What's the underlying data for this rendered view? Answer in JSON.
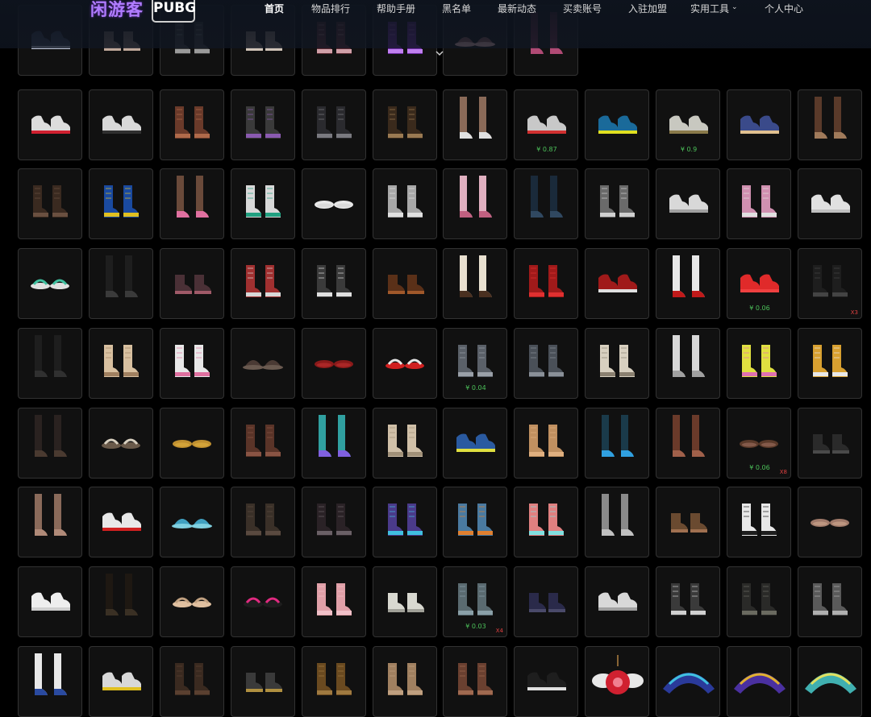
{
  "header": {
    "logo_main": "闲游客",
    "logo_sub": "PUBG",
    "nav": [
      {
        "label": "首页",
        "active": true
      },
      {
        "label": "物品排行"
      },
      {
        "label": "帮助手册"
      },
      {
        "label": "黑名单"
      },
      {
        "label": "最新动态"
      },
      {
        "label": "买卖账号"
      },
      {
        "label": "入驻加盟"
      },
      {
        "label": "实用工具",
        "dropdown": true
      },
      {
        "label": "个人中心"
      }
    ]
  },
  "colors": {
    "background": "#000000",
    "tile_border": "#323232",
    "price_green": "#4cc25a",
    "qty_red": "#e04040"
  },
  "items": [
    {
      "icon": "sneaker-pair-icon",
      "colors": [
        "#3a4256",
        "#bcc2d4"
      ]
    },
    {
      "icon": "low-boot-pair-icon",
      "colors": [
        "#7a6a62",
        "#c0a89a"
      ]
    },
    {
      "icon": "boot-pair-icon",
      "colors": [
        "#3a3a3a",
        "#9a9a9a"
      ]
    },
    {
      "icon": "low-boot-pair-icon",
      "colors": [
        "#8a7c72",
        "#d0c4b8"
      ]
    },
    {
      "icon": "boot-pair-icon",
      "colors": [
        "#5a2a32",
        "#d0a0a8"
      ]
    },
    {
      "icon": "boot-pair-icon",
      "colors": [
        "#6a2aa0",
        "#c080f0"
      ]
    },
    {
      "icon": "hat-pair-icon",
      "colors": [
        "#8a5a5a",
        "#e0b0b0"
      ]
    },
    {
      "icon": "tall-sock-pair-icon",
      "colors": [
        "#6a2a44",
        "#b04a74"
      ]
    },
    {
      "icon": "sneaker-pair-icon",
      "colors": [
        "#dcdcdc",
        "#d02030"
      ]
    },
    {
      "icon": "sneaker-pair-icon",
      "colors": [
        "#d8d8d8",
        "#303030"
      ]
    },
    {
      "icon": "boot-pair-icon",
      "colors": [
        "#6a3a2a",
        "#b06a4a"
      ]
    },
    {
      "icon": "boot-pair-icon",
      "colors": [
        "#3a3a3a",
        "#8a5ab0"
      ]
    },
    {
      "icon": "boot-pair-icon",
      "colors": [
        "#2a2a2e",
        "#7a7a80"
      ]
    },
    {
      "icon": "boot-pair-icon",
      "colors": [
        "#3a2a1c",
        "#9a7a52"
      ]
    },
    {
      "icon": "tall-sock-pair-icon",
      "colors": [
        "#8a6a58",
        "#e0e0e0"
      ]
    },
    {
      "icon": "sneaker-pair-icon",
      "colors": [
        "#c8c8c8",
        "#d03030"
      ],
      "price": "¥ 0.87"
    },
    {
      "icon": "sneaker-pair-icon",
      "colors": [
        "#1a6a9a",
        "#e0e020"
      ]
    },
    {
      "icon": "sneaker-pair-icon",
      "colors": [
        "#c8c8c0",
        "#8a7a4a"
      ],
      "price": "¥ 0.9"
    },
    {
      "icon": "sneaker-pair-icon",
      "colors": [
        "#3a4a8a",
        "#e0c090"
      ]
    },
    {
      "icon": "tall-sock-pair-icon",
      "colors": [
        "#5a3a2a",
        "#a07a5a"
      ]
    },
    {
      "icon": "boot-pair-icon",
      "colors": [
        "#3a2a20",
        "#6a5040"
      ]
    },
    {
      "icon": "boot-pair-icon",
      "colors": [
        "#1a4aa0",
        "#e0c020"
      ]
    },
    {
      "icon": "tall-sock-pair-icon",
      "colors": [
        "#6a4a3a",
        "#e070a0"
      ]
    },
    {
      "icon": "boot-pair-icon",
      "colors": [
        "#d8d8d8",
        "#20a080"
      ]
    },
    {
      "icon": "flat-pair-icon",
      "colors": [
        "#e8e8e8",
        "#d0d0d0"
      ]
    },
    {
      "icon": "boot-pair-icon",
      "colors": [
        "#a8a8a8",
        "#e0e0e0"
      ]
    },
    {
      "icon": "tall-sock-pair-icon",
      "colors": [
        "#e0b0c0",
        "#c06080"
      ]
    },
    {
      "icon": "tall-sock-pair-icon",
      "colors": [
        "#1a2a3a",
        "#304860"
      ]
    },
    {
      "icon": "boot-pair-icon",
      "colors": [
        "#6a6a6a",
        "#d0d0d0"
      ]
    },
    {
      "icon": "sneaker-pair-icon",
      "colors": [
        "#d8d8d8",
        "#a0a0a0"
      ]
    },
    {
      "icon": "boot-pair-icon",
      "colors": [
        "#d090b0",
        "#e0e0e0"
      ]
    },
    {
      "icon": "sneaker-pair-icon",
      "colors": [
        "#e0e0e0",
        "#c0c0c0"
      ]
    },
    {
      "icon": "sandal-pair-icon",
      "colors": [
        "#40c0a0",
        "#e0e0e0"
      ]
    },
    {
      "icon": "tall-sock-pair-icon",
      "colors": [
        "#1e1e1e",
        "#3a3a3a"
      ]
    },
    {
      "icon": "low-boot-pair-icon",
      "colors": [
        "#4a3036",
        "#a05a68"
      ]
    },
    {
      "icon": "boot-pair-icon",
      "colors": [
        "#a03030",
        "#d8d8d8"
      ]
    },
    {
      "icon": "boot-pair-icon",
      "colors": [
        "#3a3a3a",
        "#e0e0e0"
      ]
    },
    {
      "icon": "low-boot-pair-icon",
      "colors": [
        "#5a3018",
        "#a0582a"
      ]
    },
    {
      "icon": "tall-sock-pair-icon",
      "colors": [
        "#e8e0d0",
        "#4a3020"
      ]
    },
    {
      "icon": "boot-pair-icon",
      "colors": [
        "#a01a1a",
        "#e03030"
      ]
    },
    {
      "icon": "sneaker-pair-icon",
      "colors": [
        "#a01a1a",
        "#e0e0e0"
      ]
    },
    {
      "icon": "tall-sock-pair-icon",
      "colors": [
        "#e8e8e8",
        "#c01a1a"
      ]
    },
    {
      "icon": "sneaker-pair-icon",
      "colors": [
        "#e02a2a",
        "#f04040"
      ],
      "price": "¥ 0.06"
    },
    {
      "icon": "boot-pair-icon",
      "colors": [
        "#1e1e1e",
        "#444444"
      ],
      "qty": "X3"
    },
    {
      "icon": "tall-sock-pair-icon",
      "colors": [
        "#1e1e1e",
        "#303030"
      ]
    },
    {
      "icon": "boot-pair-icon",
      "colors": [
        "#d8c0a0",
        "#a08060"
      ]
    },
    {
      "icon": "boot-pair-icon",
      "colors": [
        "#e8e8e8",
        "#e070a0"
      ]
    },
    {
      "icon": "hat-pair-icon",
      "colors": [
        "#4a3a34",
        "#6a5a50"
      ]
    },
    {
      "icon": "flat-pair-icon",
      "colors": [
        "#8a1a1a",
        "#c03030"
      ]
    },
    {
      "icon": "sandal-pair-icon",
      "colors": [
        "#e8e8e8",
        "#d02020"
      ]
    },
    {
      "icon": "boot-pair-icon",
      "colors": [
        "#5a6068",
        "#9aa0a8"
      ],
      "price": "¥ 0.04"
    },
    {
      "icon": "boot-pair-icon",
      "colors": [
        "#4a5058",
        "#8a9098"
      ]
    },
    {
      "icon": "boot-pair-icon",
      "colors": [
        "#d8d0c0",
        "#8a8070"
      ]
    },
    {
      "icon": "tall-sock-pair-icon",
      "colors": [
        "#d8d8d8",
        "#a0a0a0"
      ]
    },
    {
      "icon": "boot-pair-icon",
      "colors": [
        "#e0e040",
        "#e070b0"
      ]
    },
    {
      "icon": "boot-pair-icon",
      "colors": [
        "#d8a030",
        "#e8e8e8"
      ]
    },
    {
      "icon": "tall-sock-pair-icon",
      "colors": [
        "#2a2220",
        "#4a3a30"
      ]
    },
    {
      "icon": "sandal-pair-icon",
      "colors": [
        "#d8d0c0",
        "#6a5a4a"
      ]
    },
    {
      "icon": "flat-pair-icon",
      "colors": [
        "#c09030",
        "#e0b040"
      ]
    },
    {
      "icon": "boot-pair-icon",
      "colors": [
        "#5a3428",
        "#8a5444"
      ]
    },
    {
      "icon": "tall-sock-pair-icon",
      "colors": [
        "#30a0a0",
        "#8060e0"
      ]
    },
    {
      "icon": "boot-pair-icon",
      "colors": [
        "#d0c0a8",
        "#a09078"
      ]
    },
    {
      "icon": "sneaker-pair-icon",
      "colors": [
        "#2a5aa0",
        "#e0e040"
      ]
    },
    {
      "icon": "boot-pair-icon",
      "colors": [
        "#c09060",
        "#e0b080"
      ]
    },
    {
      "icon": "tall-sock-pair-icon",
      "colors": [
        "#1a3a4a",
        "#30a0e0"
      ]
    },
    {
      "icon": "tall-sock-pair-icon",
      "colors": [
        "#6a3a2a",
        "#a0604a"
      ]
    },
    {
      "icon": "flat-pair-icon",
      "colors": [
        "#5a3a2a",
        "#a07060"
      ],
      "price": "¥ 0.06",
      "qty": "X8"
    },
    {
      "icon": "low-boot-pair-icon",
      "colors": [
        "#2a2a2a",
        "#4a4a4a"
      ]
    },
    {
      "icon": "tall-sock-pair-icon",
      "colors": [
        "#8a6a5a",
        "#b08a78"
      ]
    },
    {
      "icon": "sneaker-pair-icon",
      "colors": [
        "#e8e8e8",
        "#d02020"
      ]
    },
    {
      "icon": "hat-pair-icon",
      "colors": [
        "#40a0c0",
        "#80d0e0"
      ]
    },
    {
      "icon": "boot-pair-icon",
      "colors": [
        "#3a3028",
        "#5a4a40"
      ]
    },
    {
      "icon": "boot-pair-icon",
      "colors": [
        "#2a2226",
        "#6a6066"
      ]
    },
    {
      "icon": "boot-pair-icon",
      "colors": [
        "#4a3a8a",
        "#40c0e0"
      ]
    },
    {
      "icon": "boot-pair-icon",
      "colors": [
        "#4a7aa0",
        "#e08030"
      ]
    },
    {
      "icon": "boot-pair-icon",
      "colors": [
        "#e08080",
        "#80e0e0"
      ]
    },
    {
      "icon": "tall-sock-pair-icon",
      "colors": [
        "#8a8a8a",
        "#c0c0c0"
      ]
    },
    {
      "icon": "low-boot-pair-icon",
      "colors": [
        "#6a4a30",
        "#a07050"
      ]
    },
    {
      "icon": "boot-pair-icon",
      "colors": [
        "#e8e8e8",
        "#1e1e1e"
      ]
    },
    {
      "icon": "flat-pair-icon",
      "colors": [
        "#a07a6a",
        "#d0a890"
      ]
    },
    {
      "icon": "sneaker-pair-icon",
      "colors": [
        "#eeeeee",
        "#d0d0d0"
      ]
    },
    {
      "icon": "tall-sock-pair-icon",
      "colors": [
        "#1e1812",
        "#3a3024"
      ]
    },
    {
      "icon": "sandal-pair-icon",
      "colors": [
        "#c0a080",
        "#e0c0a0"
      ]
    },
    {
      "icon": "sandal-pair-icon",
      "colors": [
        "#e02a80",
        "#1e1e1e"
      ]
    },
    {
      "icon": "boot-pair-icon",
      "colors": [
        "#e0a0a8",
        "#f0c0c8"
      ]
    },
    {
      "icon": "low-boot-pair-icon",
      "colors": [
        "#d8d8d0",
        "#a0a098"
      ]
    },
    {
      "icon": "boot-pair-icon",
      "colors": [
        "#5a6a70",
        "#8aa0a8"
      ],
      "price": "¥ 0.03",
      "qty": "X4"
    },
    {
      "icon": "low-boot-pair-icon",
      "colors": [
        "#2a2a4a",
        "#4a4a6a"
      ]
    },
    {
      "icon": "sneaker-pair-icon",
      "colors": [
        "#d8d8d8",
        "#a0a0a0"
      ]
    },
    {
      "icon": "boot-pair-icon",
      "colors": [
        "#3a3a3a",
        "#d0d0d0"
      ]
    },
    {
      "icon": "boot-pair-icon",
      "colors": [
        "#2a2a28",
        "#6a6a60"
      ]
    },
    {
      "icon": "boot-pair-icon",
      "colors": [
        "#5a5a5a",
        "#b0b0b0"
      ]
    },
    {
      "icon": "tall-sock-pair-icon",
      "colors": [
        "#e8e8e8",
        "#2a4aa0"
      ]
    },
    {
      "icon": "sneaker-pair-icon",
      "colors": [
        "#d8d8d8",
        "#e0c020"
      ]
    },
    {
      "icon": "boot-pair-icon",
      "colors": [
        "#3a2a20",
        "#5a4030"
      ]
    },
    {
      "icon": "low-boot-pair-icon",
      "colors": [
        "#3a3a3a",
        "#b09040"
      ]
    },
    {
      "icon": "boot-pair-icon",
      "colors": [
        "#6a4a20",
        "#a07a40"
      ]
    },
    {
      "icon": "boot-pair-icon",
      "colors": [
        "#a08060",
        "#c0a080"
      ]
    },
    {
      "icon": "boot-pair-icon",
      "colors": [
        "#6a4030",
        "#a06a50"
      ]
    },
    {
      "icon": "sneaker-pair-icon",
      "colors": [
        "#1e1e1e",
        "#e0e0e0"
      ]
    },
    {
      "icon": "winged-heart-icon",
      "colors": [
        "#d02030",
        "#e8e8e8"
      ]
    },
    {
      "icon": "headband-icon",
      "colors": [
        "#2a3a9a",
        "#40c0e0"
      ]
    },
    {
      "icon": "headband-icon",
      "colors": [
        "#4a30a0",
        "#e0b030"
      ]
    },
    {
      "icon": "headband-icon",
      "colors": [
        "#40b0b0",
        "#e0e060"
      ]
    }
  ]
}
